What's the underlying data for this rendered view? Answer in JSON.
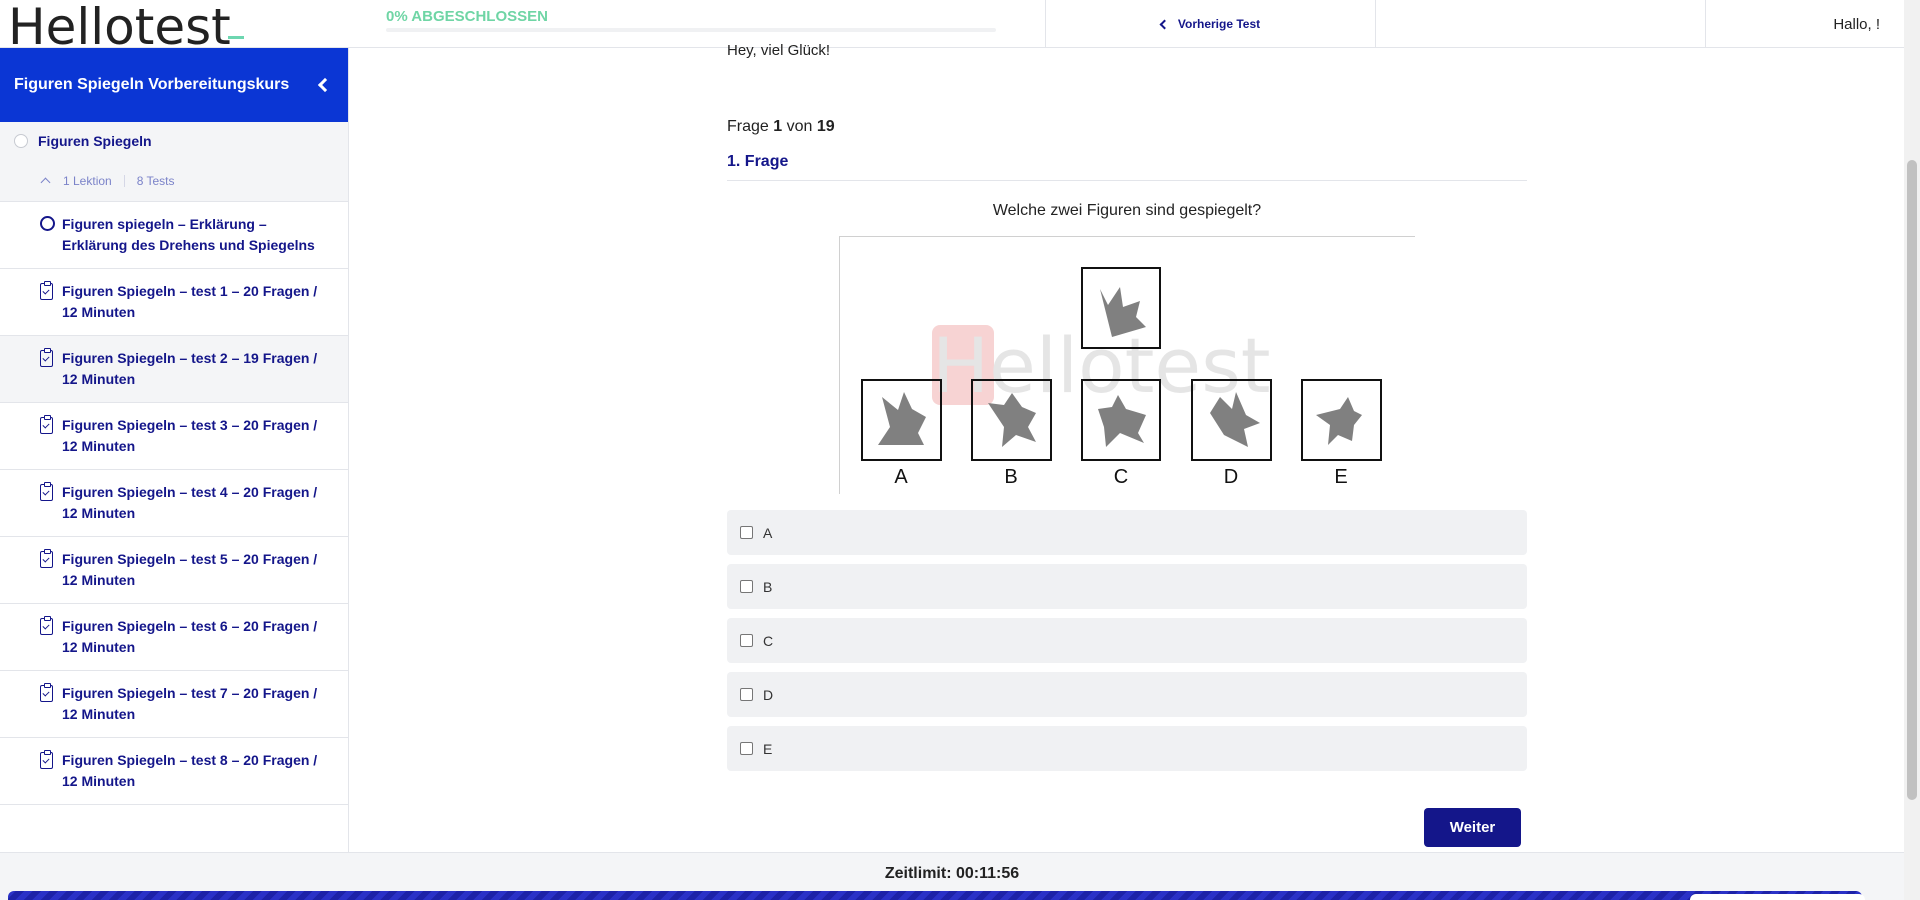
{
  "header": {
    "logo_text": "Hellotest",
    "progress_label": "0% ABGESCHLOSSEN",
    "progress_value": 0,
    "prev_test_label": "Vorherige Test",
    "user_greeting": "Hallo, !"
  },
  "sidebar": {
    "course_title": "Figuren Spiegeln Vorbereitungskurs",
    "section_title": "Figuren Spiegeln",
    "lesson_count": "1 Lektion",
    "test_count": "8 Tests",
    "items": [
      {
        "type": "lesson",
        "label": "Figuren spiegeln – Erklärung – Erklärung des Drehens und Spiegelns"
      },
      {
        "type": "quiz",
        "label": "Figuren Spiegeln – test 1 – 20 Fragen / 12 Minuten"
      },
      {
        "type": "quiz",
        "label": "Figuren Spiegeln – test 2 – 19 Fragen / 12 Minuten"
      },
      {
        "type": "quiz",
        "label": "Figuren Spiegeln – test 3 – 20 Fragen / 12 Minuten"
      },
      {
        "type": "quiz",
        "label": "Figuren Spiegeln – test 4 – 20 Fragen / 12 Minuten"
      },
      {
        "type": "quiz",
        "label": "Figuren Spiegeln – test 5 – 20 Fragen / 12 Minuten"
      },
      {
        "type": "quiz",
        "label": "Figuren Spiegeln – test 6 – 20 Fragen / 12 Minuten"
      },
      {
        "type": "quiz",
        "label": "Figuren Spiegeln – test 7 – 20 Fragen / 12 Minuten"
      },
      {
        "type": "quiz",
        "label": "Figuren Spiegeln – test 8 – 20 Fragen / 12 Minuten"
      }
    ]
  },
  "quiz": {
    "greeting": "Hey, viel Glück!",
    "frage_prefix": "Frage",
    "current": "1",
    "von": "von",
    "total": "19",
    "question_title": "1. Frage",
    "question_text": "Welche zwei Figuren sind gespiegelt?",
    "figure_watermark": "Hellotest",
    "figure_labels": [
      "A",
      "B",
      "C",
      "D",
      "E"
    ],
    "options": [
      "A",
      "B",
      "C",
      "D",
      "E"
    ],
    "next_button": "Weiter"
  },
  "footer": {
    "timer_label": "Zeitlimit: 00:11:56"
  },
  "colors": {
    "brand_blue": "#0b36d4",
    "navy": "#14168a",
    "progress_green": "#6fd5a5"
  }
}
